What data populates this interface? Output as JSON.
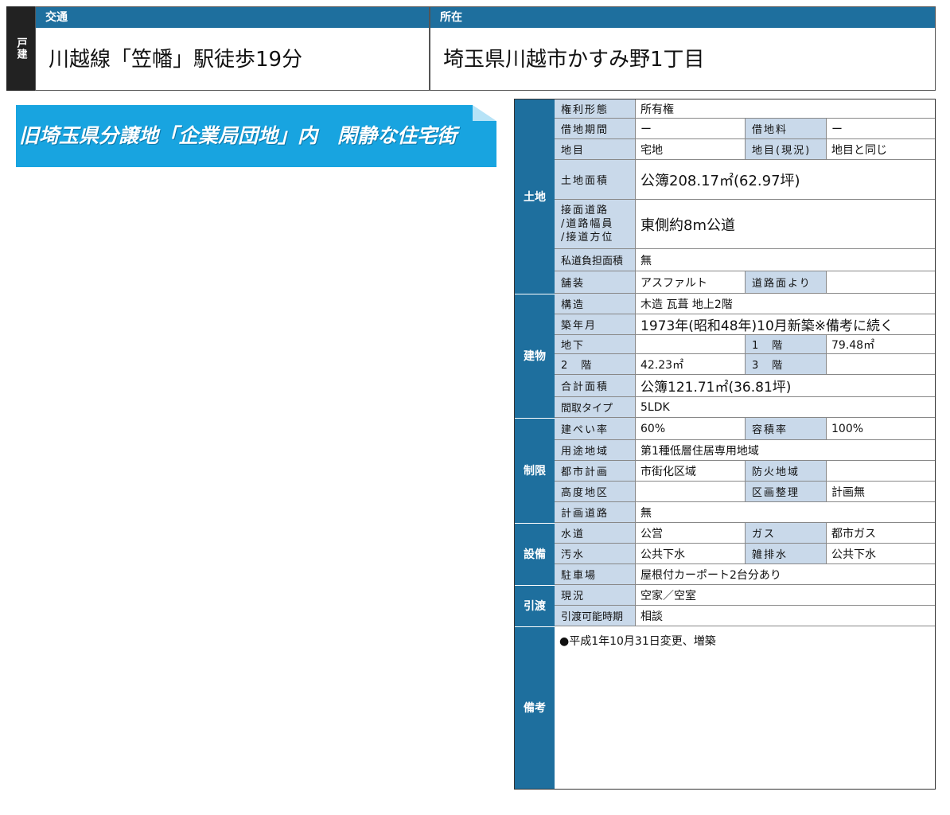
{
  "header": {
    "type_label": "戸建",
    "access_label": "交通",
    "access_value": "川越線「笠幡」駅徒歩19分",
    "location_label": "所在",
    "location_value": "埼玉県川越市かすみ野1丁目"
  },
  "banner": {
    "text": "旧埼玉県分譲地「企業局団地」内　閑静な住宅街"
  },
  "sections": {
    "land": "土地",
    "building": "建物",
    "restriction": "制限",
    "facility": "設備",
    "delivery": "引渡",
    "remarks": "備考"
  },
  "land": {
    "rights_k": "権利形態",
    "rights_v": "所有権",
    "lease_k": "借地期間",
    "lease_v": "ー",
    "rent_k": "借地料",
    "rent_v": "ー",
    "category_k": "地目",
    "category_v": "宅地",
    "category_now_k": "地目(現況)",
    "category_now_v": "地目と同じ",
    "area_k": "土地面積",
    "area_v": "公簿208.17㎡(62.97坪)",
    "road_k1": "接面道路",
    "road_k2": "/道路幅員",
    "road_k3": "/接道方位",
    "road_v": "東側約8m公道",
    "private_k": "私道負担面積",
    "private_v": "無",
    "pave_k": "舗装",
    "pave_v": "アスファルト",
    "pave_from_k": "道路面より",
    "pave_from_v": ""
  },
  "building": {
    "struct_k": "構造",
    "struct_v": "木造 瓦葺 地上2階",
    "built_k": "築年月",
    "built_v": "1973年(昭和48年)10月新築※備考に続く",
    "b1_k": "地下",
    "b1_v": "",
    "f1_k": "1　階",
    "f1_v": "79.48㎡",
    "f2_k": "2　階",
    "f2_v": "42.23㎡",
    "f3_k": "3　階",
    "f3_v": "",
    "total_k": "合計面積",
    "total_v": "公簿121.71㎡(36.81坪)",
    "layout_k": "間取タイプ",
    "layout_v": "5LDK"
  },
  "restriction": {
    "bcr_k": "建ぺい率",
    "bcr_v": "60%",
    "far_k": "容積率",
    "far_v": "100%",
    "zone_k": "用途地域",
    "zone_v": "第1種低層住居専用地域",
    "city_k": "都市計画",
    "city_v": "市街化区域",
    "fire_k": "防火地域",
    "fire_v": "",
    "height_k": "高度地区",
    "height_v": "",
    "lot_k": "区画整理",
    "lot_v": "計画無",
    "plan_k": "計画道路",
    "plan_v": "無"
  },
  "facility": {
    "water_k": "水道",
    "water_v": "公営",
    "gas_k": "ガス",
    "gas_v": "都市ガス",
    "sewage_k": "汚水",
    "sewage_v": "公共下水",
    "drain_k": "雑排水",
    "drain_v": "公共下水",
    "parking_k": "駐車場",
    "parking_v": "屋根付カーポート2台分あり"
  },
  "delivery": {
    "status_k": "現況",
    "status_v": "空家／空室",
    "time_k": "引渡可能時期",
    "time_v": "相談"
  },
  "remarks": {
    "text": "●平成1年10月31日変更、増築"
  }
}
